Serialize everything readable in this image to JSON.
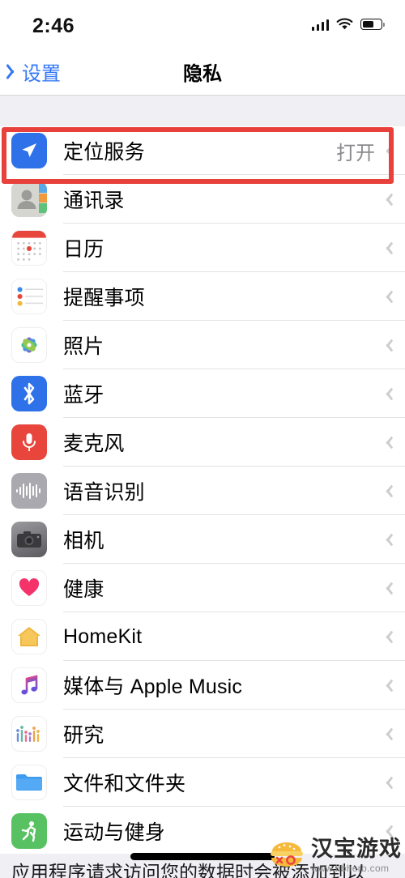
{
  "status_bar": {
    "time": "2:46",
    "signal_icon": "cellular-signal-icon",
    "wifi_icon": "wifi-icon",
    "battery_icon": "battery-icon",
    "battery_level_pct": 62
  },
  "nav_bar": {
    "back_label": "设置",
    "back_icon": "chevron-left-icon",
    "title": "隐私"
  },
  "list": {
    "rows": [
      {
        "label": "定位服务",
        "value": "打开",
        "icon": "location-arrow-icon",
        "highlighted": true
      },
      {
        "label": "通讯录",
        "value": "",
        "icon": "contacts-icon",
        "highlighted": false
      },
      {
        "label": "日历",
        "value": "",
        "icon": "calendar-icon",
        "highlighted": false
      },
      {
        "label": "提醒事项",
        "value": "",
        "icon": "reminders-icon",
        "highlighted": false
      },
      {
        "label": "照片",
        "value": "",
        "icon": "photos-icon",
        "highlighted": false
      },
      {
        "label": "蓝牙",
        "value": "",
        "icon": "bluetooth-icon",
        "highlighted": false
      },
      {
        "label": "麦克风",
        "value": "",
        "icon": "microphone-icon",
        "highlighted": false
      },
      {
        "label": "语音识别",
        "value": "",
        "icon": "speech-waveform-icon",
        "highlighted": false
      },
      {
        "label": "相机",
        "value": "",
        "icon": "camera-icon",
        "highlighted": false
      },
      {
        "label": "健康",
        "value": "",
        "icon": "heart-icon",
        "highlighted": false
      },
      {
        "label": "HomeKit",
        "value": "",
        "icon": "home-icon",
        "highlighted": false
      },
      {
        "label": "媒体与 Apple Music",
        "value": "",
        "icon": "music-note-icon",
        "highlighted": false
      },
      {
        "label": "研究",
        "value": "",
        "icon": "research-chart-icon",
        "highlighted": false
      },
      {
        "label": "文件和文件夹",
        "value": "",
        "icon": "folder-icon",
        "highlighted": false
      },
      {
        "label": "运动与健身",
        "value": "",
        "icon": "running-person-icon",
        "highlighted": false
      }
    ],
    "disclosure_icon": "chevron-right-icon"
  },
  "footer": {
    "text": "应用程序请求访问您的数据时会被添加到以"
  },
  "watermark": {
    "name": "汉宝游戏",
    "url": "www.hbherb.com",
    "logo_icon": "burger-logo-icon"
  },
  "colors": {
    "accent_blue": "#3478f6",
    "highlight_red": "#e8403a",
    "value_gray": "#8a8a8e",
    "page_gray": "#efeff4"
  }
}
